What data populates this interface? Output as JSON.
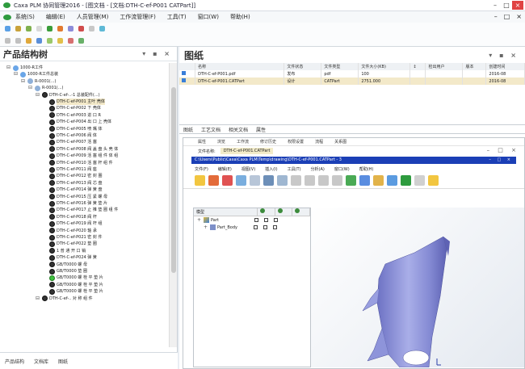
{
  "window": {
    "title": "Caxa PLM 协同管理2016 - [图文档 - [文档:DTH-C-ef-P001 CATPart]]",
    "controls": [
      "–",
      "□",
      "×"
    ]
  },
  "menu": {
    "items": [
      "系统(S)",
      "编辑(E)",
      "人员管理(M)",
      "工作流管理(F)",
      "工具(T)",
      "窗口(W)",
      "帮助(H)"
    ],
    "right_controls": [
      "–",
      "□",
      "×"
    ]
  },
  "left_panel": {
    "title": "产品结构树",
    "controls": "▾ ▪ ×",
    "tree": [
      {
        "label": "1000-R工件",
        "level": 1,
        "icon": "figure"
      },
      {
        "label": "1000-R工件总装",
        "level": 2,
        "icon": "figure"
      },
      {
        "label": "R-0001(...)",
        "level": 3,
        "icon": "node"
      },
      {
        "label": "R-0001(...)",
        "level": 4,
        "icon": "node"
      },
      {
        "label": "DTH-C-ef-..-1 总装配件(...)",
        "level": 5,
        "icon": "gear"
      },
      {
        "label": "DTH-C-ef-P001 主叶 壳体",
        "level": 6,
        "icon": "gear",
        "highlight": true
      },
      {
        "label": "DTH-C-ef-P002 下 壳体",
        "level": 6,
        "icon": "gear"
      },
      {
        "label": "DTH-C-ef-P003 进 口 R",
        "level": 6,
        "icon": "gear"
      },
      {
        "label": "DTH-C-ef-P004 出 口 上 壳体",
        "level": 6,
        "icon": "gear"
      },
      {
        "label": "DTH-C-ef-P005 喷 嘴 体",
        "level": 6,
        "icon": "gear"
      },
      {
        "label": "DTH-C-ef-P006 阀 体",
        "level": 6,
        "icon": "gear"
      },
      {
        "label": "DTH-C-ef-P007 活 塞",
        "level": 6,
        "icon": "gear"
      },
      {
        "label": "DTH-C-ef-P008 阀 盖 盘 头 壳 体",
        "level": 6,
        "icon": "gear"
      },
      {
        "label": "DTH-C-ef-P009 活 塞 组 件 体 组",
        "level": 6,
        "icon": "gear"
      },
      {
        "label": "DTH-C-ef-P010 活 塞 杆 组 件",
        "level": 6,
        "icon": "gear"
      },
      {
        "label": "DTH-C-ef-P011 阀 座",
        "level": 6,
        "icon": "gear"
      },
      {
        "label": "DTH-C-ef-P012 密 封 圈",
        "level": 6,
        "icon": "gear"
      },
      {
        "label": "DTH-C-ef-P013 阀 芯 盘",
        "level": 6,
        "icon": "gear"
      },
      {
        "label": "DTH-C-ef-P014 弹 簧 盘",
        "level": 6,
        "icon": "gear"
      },
      {
        "label": "DTH-C-ef-P015 压 紧 螺 母",
        "level": 6,
        "icon": "gear"
      },
      {
        "label": "DTH-C-ef-P016 弹 簧 垫 片",
        "level": 6,
        "icon": "gear"
      },
      {
        "label": "DTH-C-ef-P017 止 推 垫 圈 组 件",
        "level": 6,
        "icon": "gear"
      },
      {
        "label": "DTH-C-ef-P018 阀 杆",
        "level": 6,
        "icon": "gear"
      },
      {
        "label": "DTH-C-ef-P019 阀 杆 组",
        "level": 6,
        "icon": "gear"
      },
      {
        "label": "DTH-C-ef-P020 轴 承",
        "level": 6,
        "icon": "gear"
      },
      {
        "label": "DTH-C-ef-P021 密 封 件",
        "level": 6,
        "icon": "gear"
      },
      {
        "label": "DTH-C-ef-P022 垫 圈",
        "level": 6,
        "icon": "gear"
      },
      {
        "label": "1 普 通 开 口 销",
        "level": 6,
        "icon": "gear"
      },
      {
        "label": "DTH-C-ef-P024 弹 簧",
        "level": 6,
        "icon": "gear"
      },
      {
        "label": "GB/T0000 螺 母",
        "level": 6,
        "icon": "gear"
      },
      {
        "label": "GB/T0000 垫 圈",
        "level": 6,
        "icon": "gear"
      },
      {
        "label": "GB/T0000 螺 栓 平 垫 片",
        "level": 6,
        "icon": "gear",
        "green": true
      },
      {
        "label": "GB/T0000 螺 栓 平 垫 片",
        "level": 6,
        "icon": "gear"
      },
      {
        "label": "GB/T0000 螺 栓 平 垫 片",
        "level": 6,
        "icon": "gear"
      },
      {
        "label": "DTH-C-ef-.. 对 称 组 件",
        "level": 5,
        "icon": "gear"
      }
    ],
    "bottom_tabs": [
      "产品结构",
      "文档库",
      "图纸"
    ]
  },
  "right_panel": {
    "title": "图纸",
    "controls": "▾ ▪ ×",
    "table": {
      "columns": [
        "",
        "名称",
        "文件状态",
        "文件类型",
        "文件大小(KB)",
        "↕",
        "检出用户",
        "版本",
        "创建时间"
      ],
      "rows": [
        [
          "DTH-C-ef-P001.pdf",
          "发布",
          "pdf",
          "100",
          "",
          "",
          "",
          "2016-08"
        ],
        [
          "DTH-C-ef-P001.CATPart",
          "设计",
          "CATPart",
          "2751.000",
          "",
          "",
          "",
          "2016-08"
        ]
      ]
    },
    "tabs": [
      "图纸",
      "工艺文档",
      "相关文档",
      "属性"
    ]
  },
  "viewer": {
    "top_menu": [
      "属性",
      "浏览",
      "工作流",
      "修订历史",
      "权限设置",
      "流程",
      "关系图"
    ],
    "file_label": "文件名称:",
    "file_name": "DTH-C-ef-P001.CATPart",
    "address": "C:\\Users\\Public\\Caxa\\Caxa PLM\\Temp\\drawing\\DTH-C-ef-P001.CATPart - 3",
    "catia_menu": [
      "文件(F)",
      "编辑(E)",
      "视图(V)",
      "插入(I)",
      "工具(T)",
      "分析(A)",
      "窗口(W)",
      "帮助(H)"
    ],
    "spec_header": [
      "模型",
      "",
      "",
      ""
    ],
    "spec_rows": [
      "Part",
      "Part_Body"
    ]
  },
  "colors": {
    "accent": "#2e9b3e",
    "address_bar": "#1b3fb6",
    "selection": "#f3e9c9",
    "part_surface": "#8a90d6"
  }
}
